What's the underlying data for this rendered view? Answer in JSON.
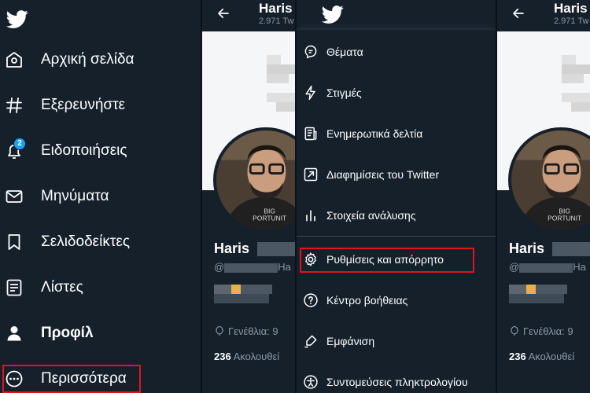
{
  "sidebar": {
    "items": [
      {
        "label": "Αρχική σελίδα",
        "icon": "home-icon"
      },
      {
        "label": "Εξερευνήστε",
        "icon": "hashtag-icon"
      },
      {
        "label": "Ειδοποιήσεις",
        "icon": "bell-icon",
        "badge": "2"
      },
      {
        "label": "Μηνύματα",
        "icon": "envelope-icon"
      },
      {
        "label": "Σελιδοδείκτες",
        "icon": "bookmark-icon"
      },
      {
        "label": "Λίστες",
        "icon": "list-icon"
      },
      {
        "label": "Προφίλ",
        "icon": "person-icon"
      },
      {
        "label": "Περισσότερα",
        "icon": "more-circle-icon"
      }
    ]
  },
  "profile": {
    "name_header": "Haris",
    "tweet_count": "2.971 Tw",
    "name": "Haris",
    "handle_prefix": "@",
    "handle_suffix": "Ha",
    "birthday": "Γενέθλια: 9",
    "following_count": "236",
    "following_label": "Ακολουθεί",
    "shirt_text_1": "BIG",
    "shirt_text_2": "PORTUNIT"
  },
  "menu": {
    "items": [
      {
        "label": "Θέματα",
        "icon": "topics-icon"
      },
      {
        "label": "Στιγμές",
        "icon": "lightning-icon"
      },
      {
        "label": "Ενημερωτικά δελτία",
        "icon": "newsletter-icon"
      },
      {
        "label": "Διαφημίσεις του Twitter",
        "icon": "ads-arrow-icon"
      },
      {
        "label": "Στοιχεία ανάλυσης",
        "icon": "analytics-icon"
      },
      {
        "label": "Ρυθμίσεις και απόρρητο",
        "icon": "gear-icon"
      },
      {
        "label": "Κέντρο βοήθειας",
        "icon": "help-icon"
      },
      {
        "label": "Εμφάνιση",
        "icon": "appearance-icon"
      },
      {
        "label": "Συντομεύσεις πληκτρολογίου",
        "icon": "accessibility-icon"
      }
    ]
  },
  "colors": {
    "background": "#15202b",
    "accent": "#1da1f2",
    "highlight": "#e0141e",
    "muted": "#8899a6"
  }
}
